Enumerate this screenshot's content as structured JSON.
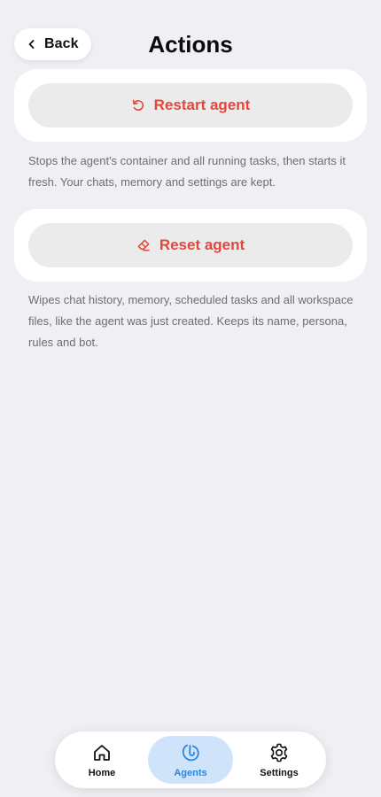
{
  "header": {
    "back_label": "Back",
    "back_icon": "chevron-left-icon",
    "title": "Actions"
  },
  "actions": [
    {
      "label": "Restart agent",
      "icon": "restart-icon",
      "description": "Stops the agent's container and all running tasks, then starts it fresh. Your chats, memory and settings are kept."
    },
    {
      "label": "Reset agent",
      "icon": "eraser-icon",
      "description": "Wipes chat history, memory, scheduled tasks and all workspace files, like the agent was just created. Keeps its name, persona, rules and bot."
    }
  ],
  "tabbar": {
    "tabs": [
      {
        "label": "Home",
        "icon": "home-icon",
        "active": false
      },
      {
        "label": "Agents",
        "icon": "agents-icon",
        "active": true
      },
      {
        "label": "Settings",
        "icon": "gear-icon",
        "active": false
      }
    ]
  },
  "colors": {
    "background": "#efeff4",
    "destructive": "#e5463b",
    "accent": "#2a86e0",
    "active_tab_bg": "#cfe3fb"
  }
}
